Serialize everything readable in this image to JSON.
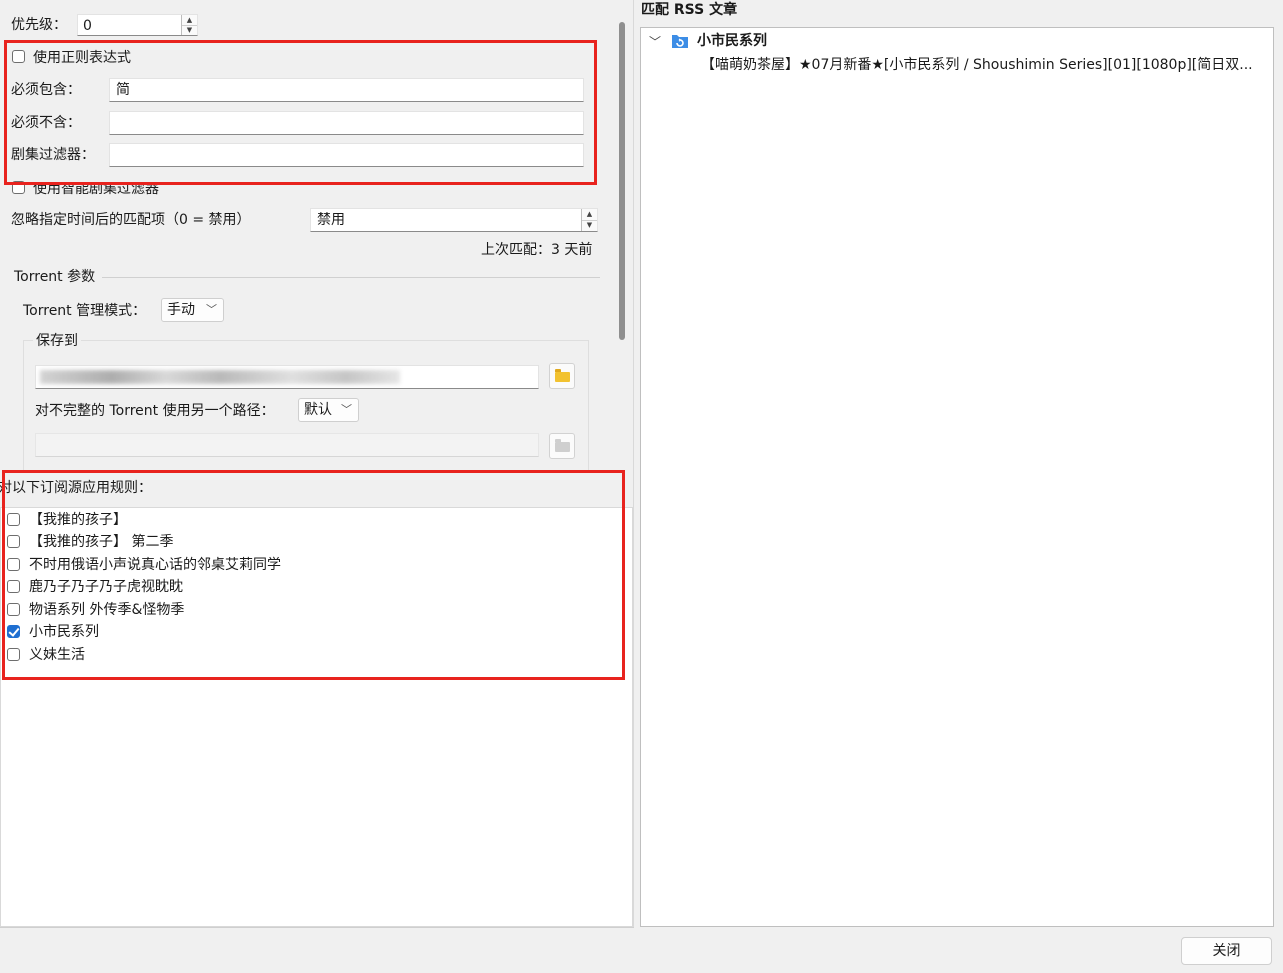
{
  "rule": {
    "priority_label": "优先级：",
    "priority_value": "0",
    "use_regex_label": "使用正则表达式",
    "must_contain_label": "必须包含：",
    "must_contain_value": "简",
    "must_not_contain_label": "必须不含：",
    "must_not_contain_value": "",
    "episode_filter_label": "剧集过滤器：",
    "episode_filter_value": "",
    "smart_filter_label": "使用智能剧集过滤器",
    "ignore_label": "忽略指定时间后的匹配项（0 = 禁用）",
    "ignore_value": "禁用",
    "last_match": "上次匹配：3 天前"
  },
  "torrent": {
    "group_label": "Torrent 参数",
    "mode_label": "Torrent 管理模式：",
    "mode_value": "手动",
    "save_to_label": "保存到",
    "incomplete_label": "对不完整的 Torrent 使用另一个路径：",
    "incomplete_value": "默认"
  },
  "feeds": {
    "header": "对以下订阅源应用规则：",
    "items": [
      {
        "label": "【我推的孩子】",
        "checked": false
      },
      {
        "label": "【我推的孩子】 第二季",
        "checked": false
      },
      {
        "label": "不时用俄语小声说真心话的邻桌艾莉同学",
        "checked": false
      },
      {
        "label": "鹿乃子乃子乃子虎视眈眈",
        "checked": false
      },
      {
        "label": "物语系列 外传季&怪物季",
        "checked": false
      },
      {
        "label": "小市民系列",
        "checked": true
      },
      {
        "label": "义妹生活",
        "checked": false
      }
    ]
  },
  "rss": {
    "title": "匹配 RSS 文章",
    "group": "小市民系列",
    "article": "【喵萌奶茶屋】★07月新番★[小市民系列 / Shoushimin Series][01][1080p][简日双..."
  },
  "footer": {
    "close_label": "关闭"
  },
  "colors": {
    "highlight_box": "#e8231e",
    "checked_accent": "#1f6fd1"
  }
}
